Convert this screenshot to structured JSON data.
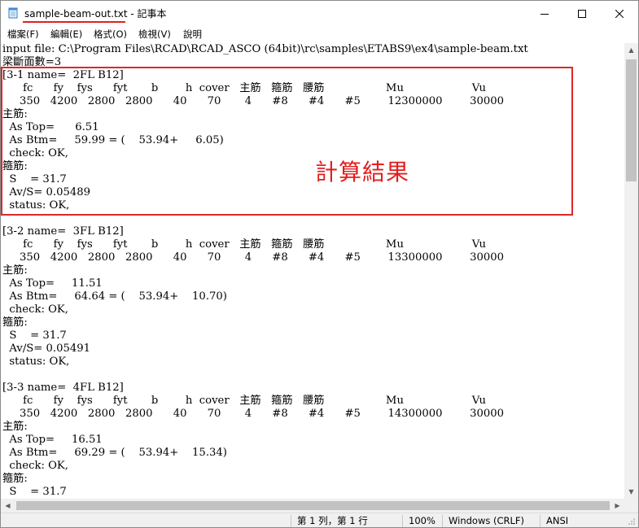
{
  "window": {
    "title_filename": "sample-beam-out.txt",
    "title_suffix": " - 記事本",
    "app_icon": "notepad-icon",
    "controls": [
      "minimize-icon",
      "maximize-icon",
      "close-icon"
    ]
  },
  "menu": [
    "檔案(F)",
    "編輯(E)",
    "格式(O)",
    "檢視(V)",
    "說明"
  ],
  "lines": [
    "input file: C:\\Program Files\\RCAD\\RCAD_ASCO (64bit)\\rc\\samples\\ETABS9\\ex4\\sample-beam.txt",
    "梁斷面數=3",
    "[3-1 name=  2FL B12]",
    "      fc      fy    fys      fyt       b        h  cover   主筋   箍筋   腰筋                  Mu                    Vu",
    "     350   4200   2800   2800      40      70       4      #8      #4      #5        12300000        30000",
    "主筋:",
    "  As Top=      6.51",
    "  As Btm=     59.99 = (    53.94+     6.05)",
    "  check: OK,",
    "箍筋:",
    "  S    = 31.7",
    "  Av/S= 0.05489",
    "  status: OK,",
    "",
    "[3-2 name=  3FL B12]",
    "      fc      fy    fys      fyt       b        h  cover   主筋   箍筋   腰筋                  Mu                    Vu",
    "     350   4200   2800   2800      40      70       4      #8      #4      #5        13300000        30000",
    "主筋:",
    "  As Top=     11.51",
    "  As Btm=     64.64 = (    53.94+    10.70)",
    "  check: OK,",
    "箍筋:",
    "  S    = 31.7",
    "  Av/S= 0.05491",
    "  status: OK,",
    "",
    "[3-3 name=  4FL B12]",
    "      fc      fy    fys      fyt       b        h  cover   主筋   箍筋   腰筋                  Mu                    Vu",
    "     350   4200   2800   2800      40      70       4      #8      #4      #5        14300000        30000",
    "主筋:",
    "  As Top=     16.51",
    "  As Btm=     69.29 = (    53.94+    15.34)",
    "  check: OK,",
    "箍筋:",
    "  S    = 31.7"
  ],
  "annotation": {
    "text": "計算結果",
    "color": "#e21d1d"
  },
  "status": {
    "position": "第 1 列，第 1 行",
    "zoom": "100%",
    "line_ending": "Windows (CRLF)",
    "encoding": "ANSI"
  }
}
